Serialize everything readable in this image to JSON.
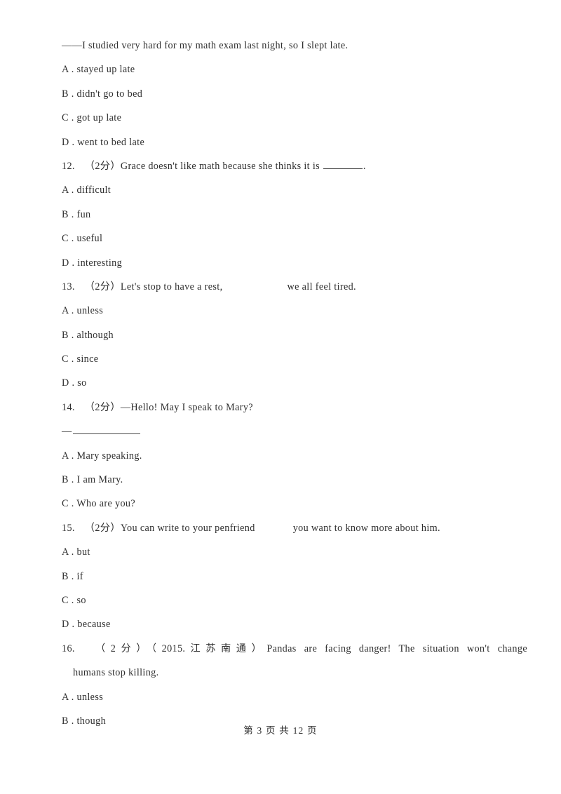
{
  "document": {
    "page_label": "第 3 页 共 12 页",
    "page_number": "3",
    "total_pages": "12",
    "text_color": "#2f2f2f",
    "background_color": "#ffffff"
  },
  "continued_question": {
    "stem_line": "——I studied very hard for my math exam last night, so I slept late.",
    "options": [
      "A . stayed up late",
      "B . didn't go to bed",
      "C . got up late",
      "D . went to bed late"
    ]
  },
  "questions": [
    {
      "number": "12.",
      "marks": "（2分）",
      "stem_before": "Grace doesn't like math because she thinks it is ",
      "stem_after": ".",
      "blank": "blank-underline",
      "options": [
        "A . difficult",
        "B . fun",
        "C . useful",
        "D . interesting"
      ]
    },
    {
      "number": "13.",
      "marks": "（2分）",
      "stem_before": "Let's stop to have a rest,",
      "stem_after": "we all feel tired.",
      "blank": "blank-whitespace",
      "options": [
        "A . unless",
        "B . although",
        "C . since",
        "D . so"
      ]
    },
    {
      "number": "14.",
      "marks": "（2分）",
      "stem_before": "—Hello! May I speak to Mary?",
      "stem_after": "",
      "answer_prompt_dash": "—",
      "blank": "blank-underline-long",
      "options": [
        "A . Mary speaking.",
        "B . I am Mary.",
        "C . Who are you?"
      ]
    },
    {
      "number": "15.",
      "marks": "（2分）",
      "stem_before": "You can write to your penfriend",
      "stem_after": "you want to know more about him.",
      "blank": "blank-whitespace",
      "options": [
        "A . but",
        "B . if",
        "C . so",
        "D . because"
      ]
    },
    {
      "number": "16.",
      "marks": "（2分）",
      "source": "（2015.江苏南通）",
      "stem_line1": "Pandas are facing danger! The situation won't change",
      "stem_line2": "humans stop killing.",
      "options": [
        "A . unless",
        "B . though"
      ]
    }
  ]
}
